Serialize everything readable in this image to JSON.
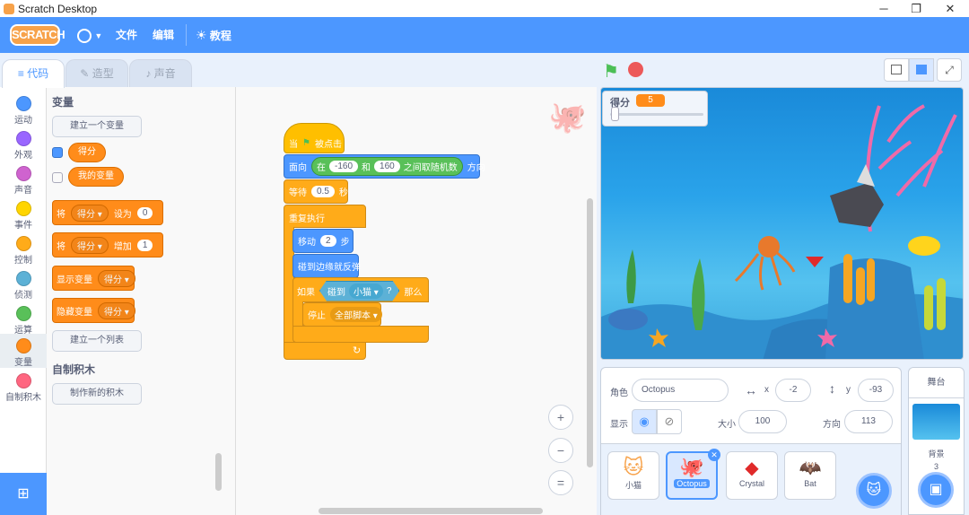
{
  "window": {
    "title": "Scratch Desktop",
    "minimize": "─",
    "maximize": "❐",
    "close": "✕"
  },
  "menu": {
    "logo": "SCRATCH",
    "file": "文件",
    "edit": "编辑",
    "tutorials": "教程"
  },
  "tabs": {
    "code": "代码",
    "costumes": "造型",
    "sounds": "声音"
  },
  "categories": [
    {
      "label": "运动",
      "color": "#4c97ff"
    },
    {
      "label": "外观",
      "color": "#9966ff"
    },
    {
      "label": "声音",
      "color": "#cf63cf"
    },
    {
      "label": "事件",
      "color": "#ffd500"
    },
    {
      "label": "控制",
      "color": "#ffab19"
    },
    {
      "label": "侦测",
      "color": "#5cb1d6"
    },
    {
      "label": "运算",
      "color": "#59c059"
    },
    {
      "label": "变量",
      "color": "#ff8c1a"
    },
    {
      "label": "自制积木",
      "color": "#ff6680"
    }
  ],
  "palette": {
    "variables_title": "变量",
    "make_variable": "建立一个变量",
    "var_score": "得分",
    "var_my": "我的变量",
    "set_label": "将",
    "set_var": "得分",
    "set_to": "设为",
    "set_value": "0",
    "change_label": "将",
    "change_var": "得分",
    "change_by": "增加",
    "change_value": "1",
    "show_label": "显示变量",
    "show_var": "得分",
    "hide_label": "隐藏变量",
    "hide_var": "得分",
    "make_list": "建立一个列表",
    "myblocks_title": "自制积木",
    "make_block": "制作新的积木"
  },
  "script": {
    "when": "当",
    "flag_clicked": "被点击",
    "point_label": "面向",
    "in_label": "在",
    "rand_from": "-160",
    "and_label": "和",
    "rand_to": "160",
    "rand_suffix": "之间取随机数",
    "dir_label": "方向",
    "wait_label": "等待",
    "wait_value": "0.5",
    "wait_unit": "秒",
    "forever": "重复执行",
    "move_label": "移动",
    "move_value": "2",
    "move_unit": "步",
    "bounce": "碰到边缘就反弹",
    "if_label": "如果",
    "touching": "碰到",
    "touch_target": "小猫",
    "qmark": "?",
    "then_label": "那么",
    "stop_label": "停止",
    "stop_option": "全部脚本"
  },
  "zoom": {
    "in": "+",
    "out": "−",
    "reset": "="
  },
  "monitor": {
    "label": "得分",
    "value": "5"
  },
  "sprite_info": {
    "sprite_label": "角色",
    "sprite_name": "Octopus",
    "x_label": "x",
    "x_value": "-2",
    "y_label": "y",
    "y_value": "-93",
    "show_label": "显示",
    "size_label": "大小",
    "size_value": "100",
    "direction_label": "方向",
    "direction_value": "113"
  },
  "sprites": [
    {
      "name": "小猫"
    },
    {
      "name": "Octopus"
    },
    {
      "name": "Crystal"
    },
    {
      "name": "Bat"
    }
  ],
  "stage_panel": {
    "title": "舞台",
    "backdrops_label": "背景",
    "backdrops_count": "3"
  }
}
